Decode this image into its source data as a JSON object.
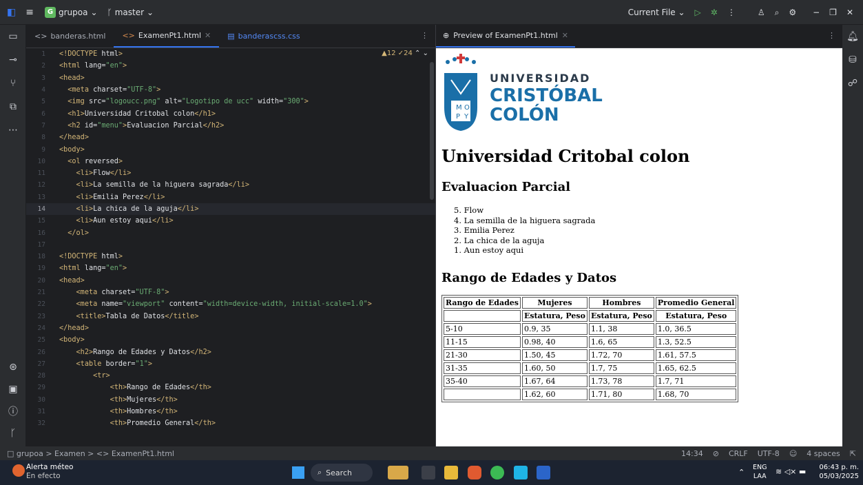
{
  "titlebar": {
    "project": "grupoa",
    "project_badge": "G",
    "branch": "master",
    "run_config": "Current File"
  },
  "editor_tabs": [
    {
      "label": "banderas.html",
      "active": false
    },
    {
      "label": "ExamenPt1.html",
      "active": true
    },
    {
      "label": "banderascss.css",
      "active": false
    }
  ],
  "inspections": "▲12 ✓24",
  "code_lines": [
    {
      "n": "1",
      "text": "<!DOCTYPE html>"
    },
    {
      "n": "2",
      "text": "<html lang=\"en\">"
    },
    {
      "n": "3",
      "text": "<head>"
    },
    {
      "n": "4",
      "text": "  <meta charset=\"UTF-8\">"
    },
    {
      "n": "5",
      "text": "  <img src=\"logoucc.png\" alt=\"Logotipo de ucc\" width=\"300\">"
    },
    {
      "n": "6",
      "text": "  <h1>Universidad Critobal colon</h1>"
    },
    {
      "n": "7",
      "text": "  <h2 id=\"menu\">Evaluacion Parcial</h2>"
    },
    {
      "n": "8",
      "text": "</head>"
    },
    {
      "n": "9",
      "text": "<body>"
    },
    {
      "n": "10",
      "text": "  <ol reversed>"
    },
    {
      "n": "11",
      "text": "    <li>Flow</li>"
    },
    {
      "n": "12",
      "text": "    <li>La semilla de la higuera sagrada</li>"
    },
    {
      "n": "13",
      "text": "    <li>Emilia Perez</li>"
    },
    {
      "n": "14",
      "text": "    <li>La chica de la aguja</li>"
    },
    {
      "n": "15",
      "text": "    <li>Aun estoy aqui</li>"
    },
    {
      "n": "16",
      "text": "  </ol>"
    },
    {
      "n": "17",
      "text": ""
    },
    {
      "n": "18",
      "text": "<!DOCTYPE html>"
    },
    {
      "n": "19",
      "text": "<html lang=\"en\">"
    },
    {
      "n": "20",
      "text": "<head>"
    },
    {
      "n": "21",
      "text": "    <meta charset=\"UTF-8\">"
    },
    {
      "n": "22",
      "text": "    <meta name=\"viewport\" content=\"width=device-width, initial-scale=1.0\">"
    },
    {
      "n": "23",
      "text": "    <title>Tabla de Datos</title>"
    },
    {
      "n": "24",
      "text": "</head>"
    },
    {
      "n": "25",
      "text": "<body>"
    },
    {
      "n": "26",
      "text": "    <h2>Rango de Edades y Datos</h2>"
    },
    {
      "n": "27",
      "text": "    <table border=\"1\">"
    },
    {
      "n": "28",
      "text": "        <tr>"
    },
    {
      "n": "29",
      "text": "            <th>Rango de Edades</th>"
    },
    {
      "n": "30",
      "text": "            <th>Mujeres</th>"
    },
    {
      "n": "31",
      "text": "            <th>Hombres</th>"
    },
    {
      "n": "32",
      "text": "            <th>Promedio General</th>"
    }
  ],
  "current_line": "14",
  "preview": {
    "tab": "Preview of ExamenPt1.html",
    "logo_line1": "UNIVERSIDAD",
    "logo_line2": "CRISTÓBAL",
    "logo_line3": "COLÓN",
    "h1": "Universidad Critobal colon",
    "h2": "Evaluacion Parcial",
    "list": [
      "5. Flow",
      "4. La semilla de la higuera sagrada",
      "3. Emilia Perez",
      "2. La chica de la aguja",
      "1. Aun estoy aqui"
    ],
    "table_title": "Rango de Edades y Datos",
    "headers": [
      "Rango de Edades",
      "Mujeres",
      "Hombres",
      "Promedio General"
    ],
    "subheaders": [
      "",
      "Estatura, Peso",
      "Estatura, Peso",
      "Estatura, Peso"
    ],
    "rows": [
      [
        "5-10",
        "0.9, 35",
        "1.1, 38",
        "1.0, 36.5"
      ],
      [
        "11-15",
        "0.98, 40",
        "1.6, 65",
        "1.3, 52.5"
      ],
      [
        "21-30",
        "1.50, 45",
        "1.72, 70",
        "1.61, 57.5"
      ],
      [
        "31-35",
        "1.60, 50",
        "1.7, 75",
        "1.65, 62.5"
      ],
      [
        "35-40",
        "1.67, 64",
        "1.73, 78",
        "1.7, 71"
      ],
      [
        "",
        "1.62, 60",
        "1.71, 80",
        "1.68, 70"
      ]
    ]
  },
  "statusbar": {
    "breadcrumb": "□ grupoa  >  Examen  >  <> ExamenPt1.html",
    "position": "14:34",
    "line_sep": "CRLF",
    "encoding": "UTF-8",
    "indent": "4 spaces"
  },
  "taskbar": {
    "weather_title": "Alerta méteo",
    "weather_sub": "En efecto",
    "search": "Search",
    "lang": "ENG",
    "lang2": "LAA",
    "time": "06:43 p. m.",
    "date": "05/03/2025"
  }
}
